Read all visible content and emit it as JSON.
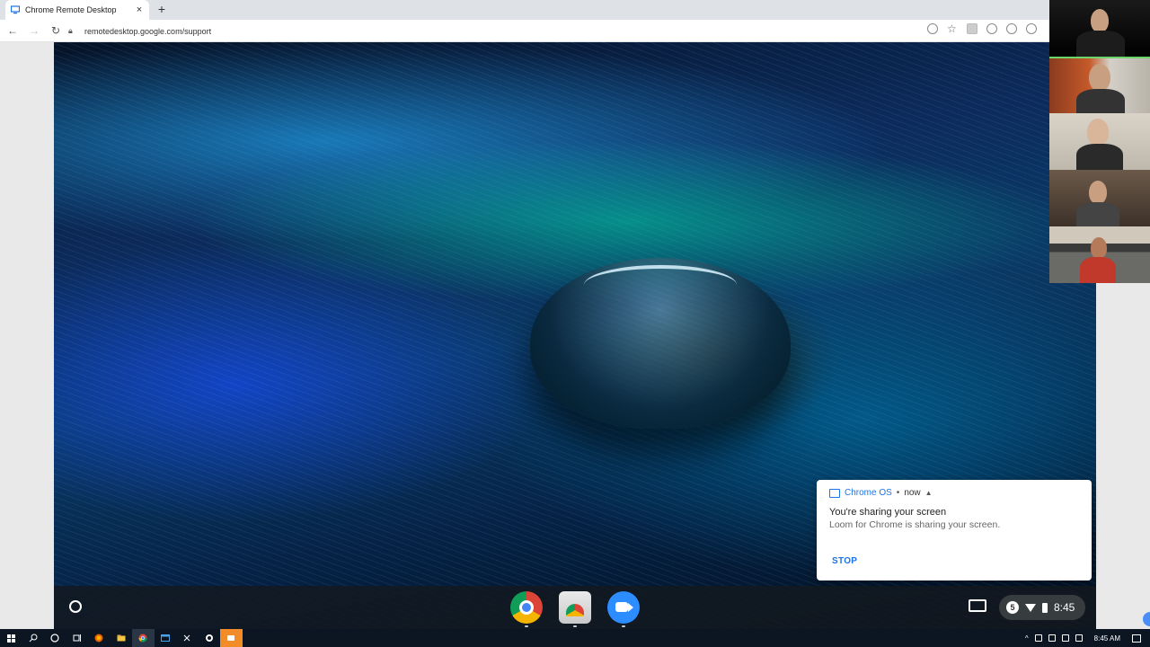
{
  "browser": {
    "tab_title": "Chrome Remote Desktop",
    "tab_close": "×",
    "new_tab": "+",
    "url": "remotedesktop.google.com/support",
    "back": "←",
    "forward": "→",
    "reload": "↻",
    "star": "☆"
  },
  "notification": {
    "app": "Chrome OS",
    "separator": "•",
    "time": "now",
    "chevron": "▲",
    "title": "You're sharing your screen",
    "body": "Loom for Chrome is sharing your screen.",
    "action": "STOP"
  },
  "shelf": {
    "apps": [
      "Chrome",
      "Files",
      "Zoom"
    ],
    "status_badge": "5",
    "clock": "8:45"
  },
  "taskbar": {
    "time": "8:45 AM"
  },
  "colors": {
    "accent": "#1a73e8",
    "shelf_bg": "#14191e",
    "taskbar_bg": "#0c1522"
  }
}
